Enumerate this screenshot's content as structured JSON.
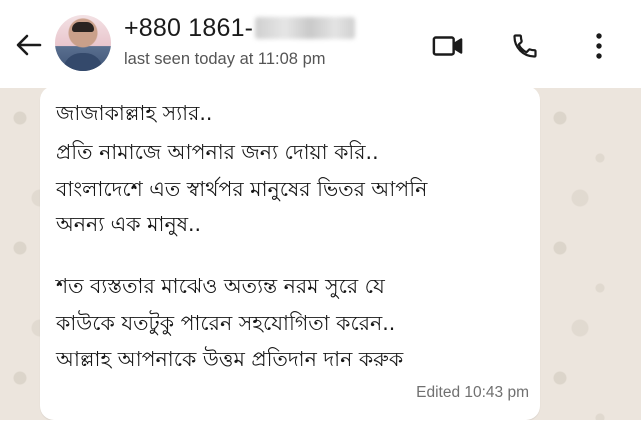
{
  "header": {
    "contact_name": "+880 1861-",
    "status": "last seen today at 11:08 pm",
    "back_icon": "arrow-left-icon",
    "video_icon": "video-call-icon",
    "voice_icon": "phone-icon",
    "menu_icon": "more-vertical-icon"
  },
  "message": {
    "lines": [
      "জাজাকাল্লাহ স্যার..",
      "প্রতি নামাজে আপনার জন্য দোয়া করি..",
      "বাংলাদেশে এত স্বার্থপর মানুষের ভিতর আপনি",
      "অনন্য এক মানুষ..",
      "শত ব্যস্ততার মাঝেও অত্যন্ত নরম সুরে যে",
      "কাউকে যতটুকু পারেন সহযোগিতা করেন..",
      "আল্লাহ আপনাকে উত্তম প্রতিদান দান করুক"
    ],
    "meta": "Edited 10:43 pm"
  },
  "colors": {
    "chat_background": "#ece5dd",
    "bubble": "#ffffff",
    "text": "#161616"
  }
}
